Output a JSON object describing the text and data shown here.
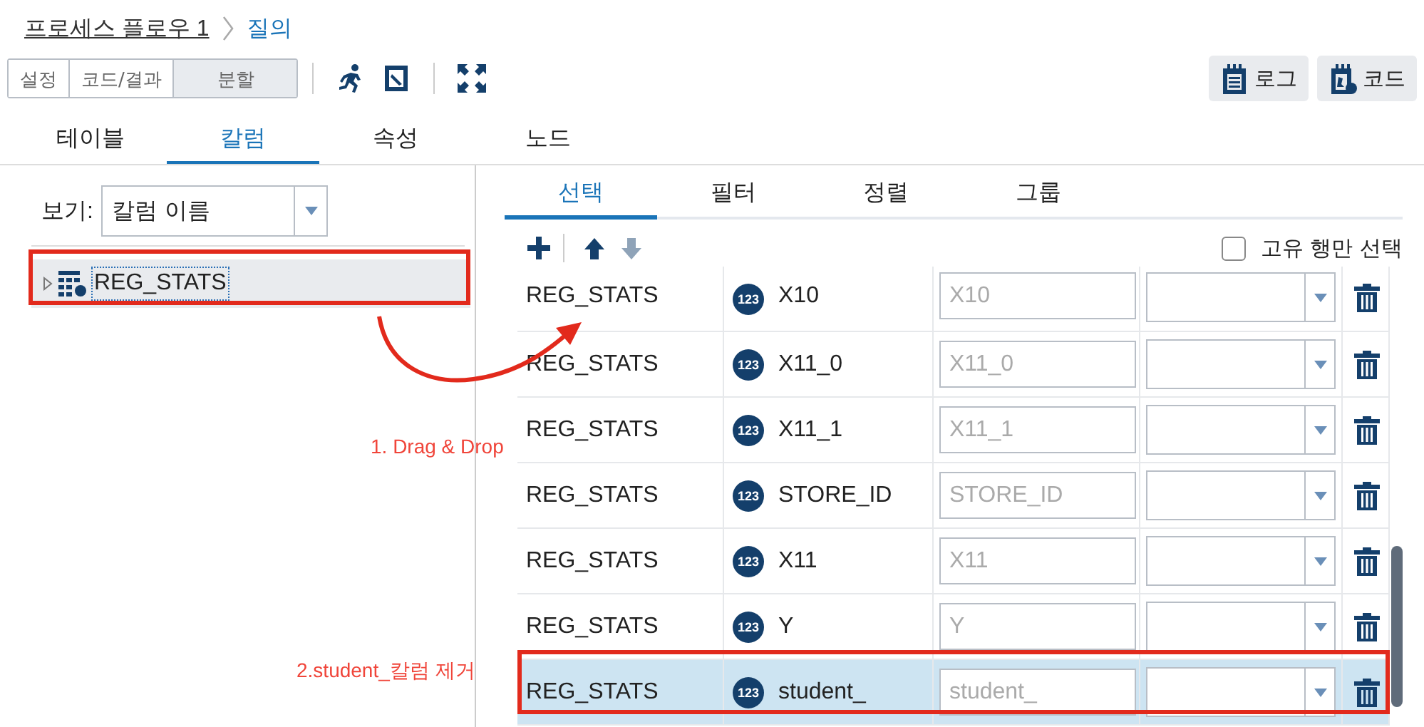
{
  "breadcrumb": [
    {
      "label": "프로세스 플로우 1",
      "kind": "link"
    },
    {
      "label": "질의",
      "kind": "current"
    }
  ],
  "view_modes": [
    {
      "label": "설정",
      "selected": false
    },
    {
      "label": "코드/결과",
      "selected": false
    },
    {
      "label": "분할",
      "selected": true
    }
  ],
  "action_buttons": [
    {
      "label": "로그"
    },
    {
      "label": "코드"
    }
  ],
  "tabs": [
    {
      "label": "테이블",
      "selected": false
    },
    {
      "label": "칼럼",
      "selected": true
    },
    {
      "label": "속성",
      "selected": false
    },
    {
      "label": "노드",
      "selected": false
    }
  ],
  "left_panel": {
    "view_label": "보기:",
    "view_value": "칼럼 이름",
    "tree": [
      {
        "label": "REG_STATS",
        "expanded": false,
        "selected": true
      }
    ]
  },
  "right_panel": {
    "subtabs": [
      {
        "label": "선택",
        "selected": true
      },
      {
        "label": "필터",
        "selected": false
      },
      {
        "label": "정렬",
        "selected": false
      },
      {
        "label": "그룹",
        "selected": false
      }
    ],
    "distinct_checkbox": {
      "label": "고유 행만 선택",
      "checked": false
    },
    "rows": [
      {
        "table": "REG_STATS",
        "type": "123",
        "column": "X10",
        "alias_placeholder": "X10",
        "selected": false
      },
      {
        "table": "REG_STATS",
        "type": "123",
        "column": "X11_0",
        "alias_placeholder": "X11_0",
        "selected": false
      },
      {
        "table": "REG_STATS",
        "type": "123",
        "column": "X11_1",
        "alias_placeholder": "X11_1",
        "selected": false
      },
      {
        "table": "REG_STATS",
        "type": "123",
        "column": "STORE_ID",
        "alias_placeholder": "STORE_ID",
        "selected": false
      },
      {
        "table": "REG_STATS",
        "type": "123",
        "column": "X11",
        "alias_placeholder": "X11",
        "selected": false
      },
      {
        "table": "REG_STATS",
        "type": "123",
        "column": "Y",
        "alias_placeholder": "Y",
        "selected": false
      },
      {
        "table": "REG_STATS",
        "type": "123",
        "column": "student_",
        "alias_placeholder": "student_",
        "selected": true
      }
    ]
  },
  "annotations": [
    {
      "text": "1. Drag & Drop",
      "kind": "drag"
    },
    {
      "text": "2.student_칼럼 제거",
      "kind": "remove"
    }
  ]
}
